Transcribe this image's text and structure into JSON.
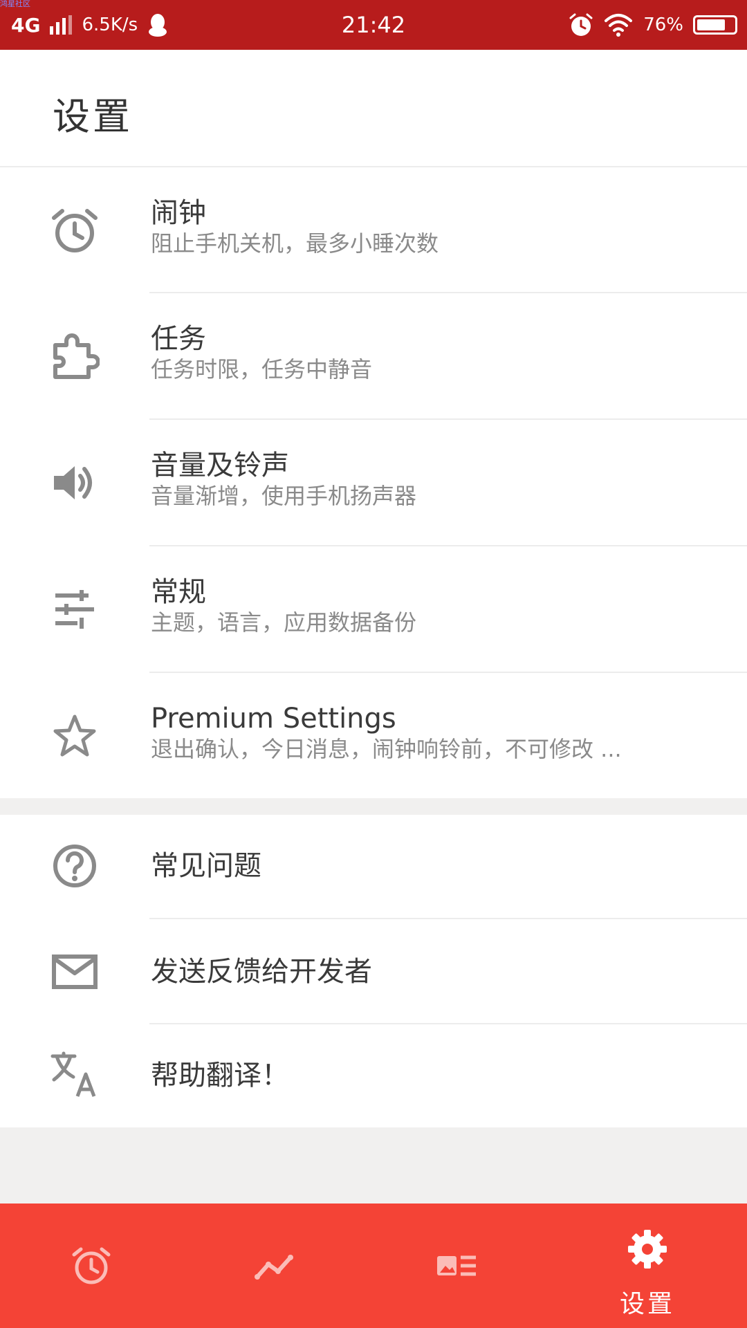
{
  "status_bar": {
    "corner_label": "鸿星社区",
    "network": "4G",
    "speed": "6.5K/s",
    "time": "21:42",
    "battery_percent_text": "76%",
    "battery_level": 0.76
  },
  "header": {
    "title": "设置"
  },
  "group1": [
    {
      "icon": "alarm-clock-icon",
      "title": "闹钟",
      "subtitle": "阻止手机关机，最多小睡次数"
    },
    {
      "icon": "puzzle-piece-icon",
      "title": "任务",
      "subtitle": "任务时限，任务中静音"
    },
    {
      "icon": "speaker-volume-icon",
      "title": "音量及铃声",
      "subtitle": "音量渐增，使用手机扬声器"
    },
    {
      "icon": "sliders-tune-icon",
      "title": "常规",
      "subtitle": "主题，语言，应用数据备份"
    },
    {
      "icon": "star-outline-icon",
      "title": "Premium Settings",
      "subtitle": "退出确认，今日消息，闹钟响铃前，不可修改 ..."
    }
  ],
  "group2": [
    {
      "icon": "help-circle-icon",
      "title": "常见问题"
    },
    {
      "icon": "mail-envelope-icon",
      "title": "发送反馈给开发者"
    },
    {
      "icon": "translate-icon",
      "title": "帮助翻译！"
    }
  ],
  "bottom_nav": {
    "items": [
      {
        "icon": "alarm-tab-icon",
        "label": ""
      },
      {
        "icon": "trend-chart-icon",
        "label": ""
      },
      {
        "icon": "news-feed-icon",
        "label": ""
      },
      {
        "icon": "gear-icon",
        "label": "设置",
        "active": true
      }
    ]
  },
  "colors": {
    "status_bar": "#b71c1c",
    "bottom_nav": "#f44336",
    "icon_gray": "#8a8a8a"
  }
}
